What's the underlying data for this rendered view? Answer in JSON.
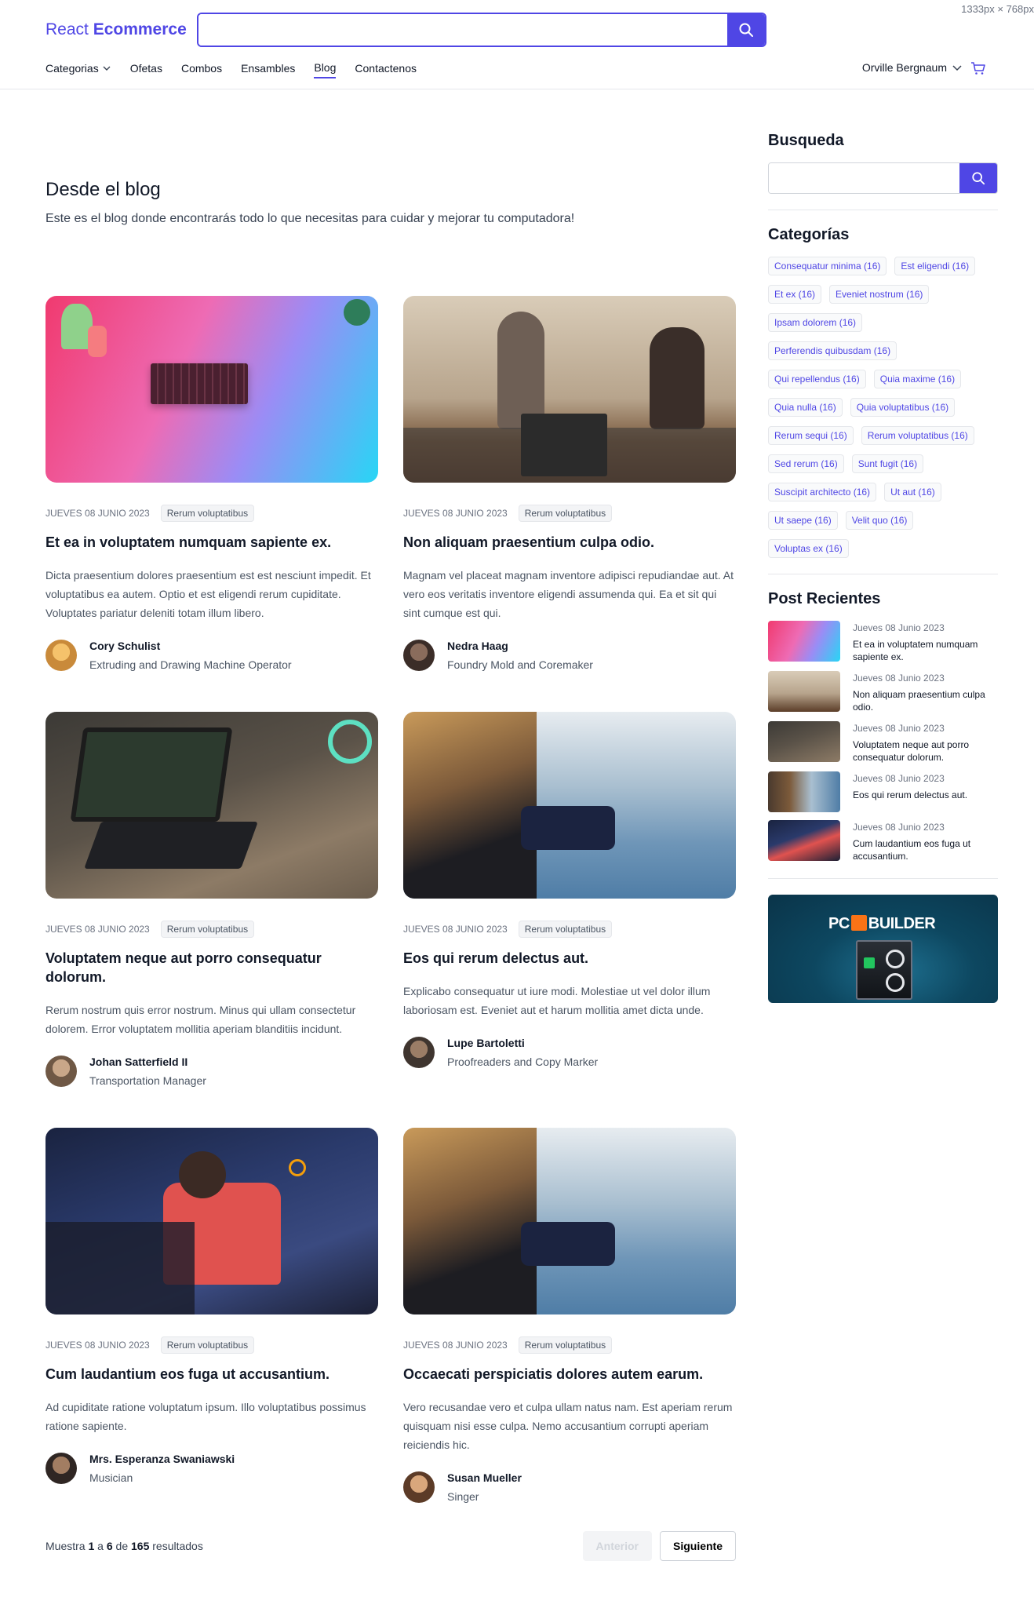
{
  "meta": {
    "dims": "1333px × 768px"
  },
  "header": {
    "logo_prefix": "React",
    "logo_brand": "Ecommerce",
    "search_placeholder": "",
    "nav": [
      "Categorias",
      "Ofetas",
      "Combos",
      "Ensambles",
      "Blog",
      "Contactenos"
    ],
    "user_name": "Orville Bergnaum"
  },
  "blog": {
    "title": "Desde el blog",
    "subtitle": "Este es el blog donde encontrarás todo lo que necesitas para cuidar y mejorar tu computadora!"
  },
  "posts": [
    {
      "date": "JUEVES 08 JUNIO 2023",
      "tag": "Rerum voluptatibus",
      "title": "Et ea in voluptatem numquam sapiente ex.",
      "excerpt": "Dicta praesentium dolores praesentium est est nesciunt impedit. Et voluptatibus ea autem. Optio et est eligendi rerum cupiditate. Voluptates pariatur deleniti totam illum libero.",
      "author": "Cory Schulist",
      "role": "Extruding and Drawing Machine Operator"
    },
    {
      "date": "JUEVES 08 JUNIO 2023",
      "tag": "Rerum voluptatibus",
      "title": "Non aliquam praesentium culpa odio.",
      "excerpt": "Magnam vel placeat magnam inventore adipisci repudiandae aut. At vero eos veritatis inventore eligendi assumenda qui. Ea et sit qui sint cumque est qui.",
      "author": "Nedra Haag",
      "role": "Foundry Mold and Coremaker"
    },
    {
      "date": "JUEVES 08 JUNIO 2023",
      "tag": "Rerum voluptatibus",
      "title": "Voluptatem neque aut porro consequatur dolorum.",
      "excerpt": "Rerum nostrum quis error nostrum. Minus qui ullam consectetur dolorem. Error voluptatem mollitia aperiam blanditiis incidunt.",
      "author": "Johan Satterfield II",
      "role": "Transportation Manager"
    },
    {
      "date": "JUEVES 08 JUNIO 2023",
      "tag": "Rerum voluptatibus",
      "title": "Eos qui rerum delectus aut.",
      "excerpt": "Explicabo consequatur ut iure modi. Molestiae ut vel dolor illum laboriosam est. Eveniet aut et harum mollitia amet dicta unde.",
      "author": "Lupe Bartoletti",
      "role": "Proofreaders and Copy Marker"
    },
    {
      "date": "JUEVES 08 JUNIO 2023",
      "tag": "Rerum voluptatibus",
      "title": "Cum laudantium eos fuga ut accusantium.",
      "excerpt": "Ad cupiditate ratione voluptatum ipsum. Illo voluptatibus possimus ratione sapiente.",
      "author": "Mrs. Esperanza Swaniawski",
      "role": "Musician"
    },
    {
      "date": "JUEVES 08 JUNIO 2023",
      "tag": "Rerum voluptatibus",
      "title": "Occaecati perspiciatis dolores autem earum.",
      "excerpt": "Vero recusandae vero et culpa ullam natus nam. Est aperiam rerum quisquam nisi esse culpa. Nemo accusantium corrupti aperiam reiciendis hic.",
      "author": "Susan Mueller",
      "role": "Singer"
    }
  ],
  "pagination": {
    "prefix": "Muestra",
    "from": "1",
    "sep": "a",
    "to": "6",
    "of": "de",
    "total": "165",
    "suffix": "resultados",
    "prev": "Anterior",
    "next": "Siguiente"
  },
  "sidebar": {
    "search_title": "Busqueda",
    "categories_title": "Categorías",
    "categories": [
      "Consequatur minima (16)",
      "Est eligendi (16)",
      "Et ex (16)",
      "Eveniet nostrum (16)",
      "Ipsam dolorem (16)",
      "Perferendis quibusdam (16)",
      "Qui repellendus (16)",
      "Quia maxime (16)",
      "Quia nulla (16)",
      "Quia voluptatibus (16)",
      "Rerum sequi (16)",
      "Rerum voluptatibus (16)",
      "Sed rerum (16)",
      "Sunt fugit (16)",
      "Suscipit architecto (16)",
      "Ut aut (16)",
      "Ut saepe (16)",
      "Velit quo (16)",
      "Voluptas ex (16)"
    ],
    "recent_title": "Post Recientes",
    "recent": [
      {
        "date": "Jueves 08 Junio 2023",
        "title": "Et ea in voluptatem numquam sapiente ex."
      },
      {
        "date": "Jueves 08 Junio 2023",
        "title": "Non aliquam praesentium culpa odio."
      },
      {
        "date": "Jueves 08 Junio 2023",
        "title": "Voluptatem neque aut porro consequatur dolorum."
      },
      {
        "date": "Jueves 08 Junio 2023",
        "title": "Eos qui rerum delectus aut."
      },
      {
        "date": "Jueves 08 Junio 2023",
        "title": "Cum laudantium eos fuga ut accusantium."
      }
    ],
    "banner_text_left": "PC",
    "banner_text_right": "BUILDER"
  },
  "colors": {
    "accent": "#4f46e5",
    "text": "#111827",
    "muted": "#4b5563"
  }
}
